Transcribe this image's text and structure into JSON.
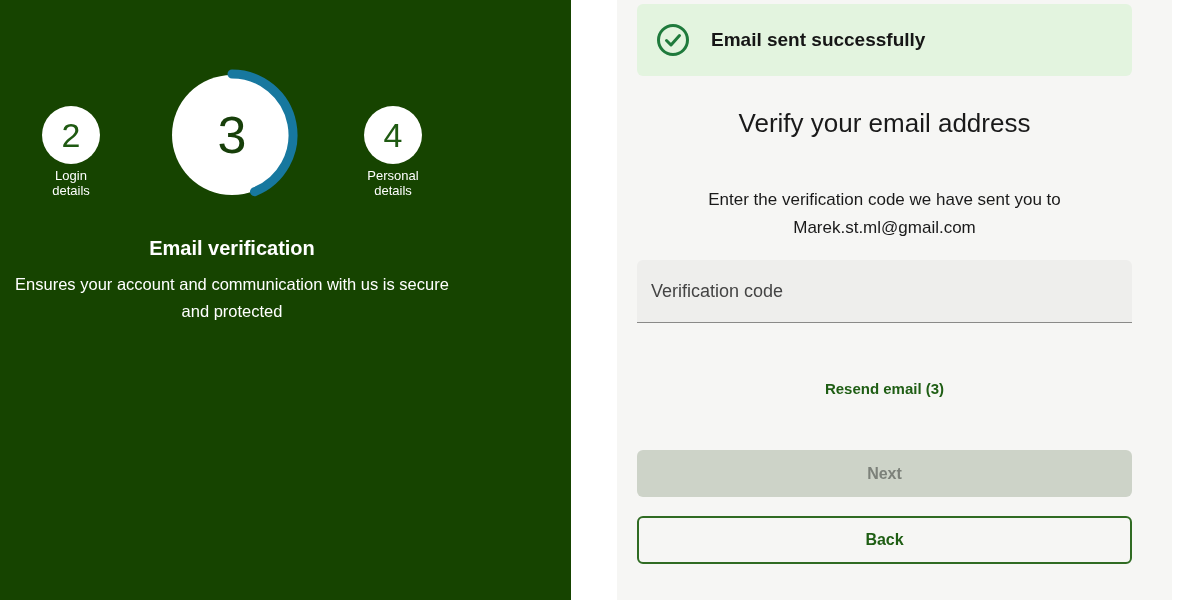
{
  "stepper": {
    "steps": [
      {
        "number": "2",
        "label": "Login details",
        "selected": false
      },
      {
        "number": "3",
        "selected": true,
        "level": 0.44
      },
      {
        "number": "4",
        "label": "Personal details",
        "selected": false
      }
    ],
    "title": "Email verification",
    "description": "Ensures your account and communication with us is secure and protected"
  },
  "alert": {
    "kind": "success",
    "message": "Email sent successfully"
  },
  "form": {
    "heading": "Verify your email address",
    "instruction": "Enter the verification code we have sent you to",
    "email": "Marek.st.ml@gmail.com",
    "code_field": {
      "placeholder": "Verification code"
    },
    "resend_link": "Resend email (3)",
    "buttons": [
      {
        "label": "Next",
        "kind": "primary",
        "disabled": true
      },
      {
        "label": "Back",
        "kind": "secondary",
        "disabled": false
      }
    ]
  }
}
